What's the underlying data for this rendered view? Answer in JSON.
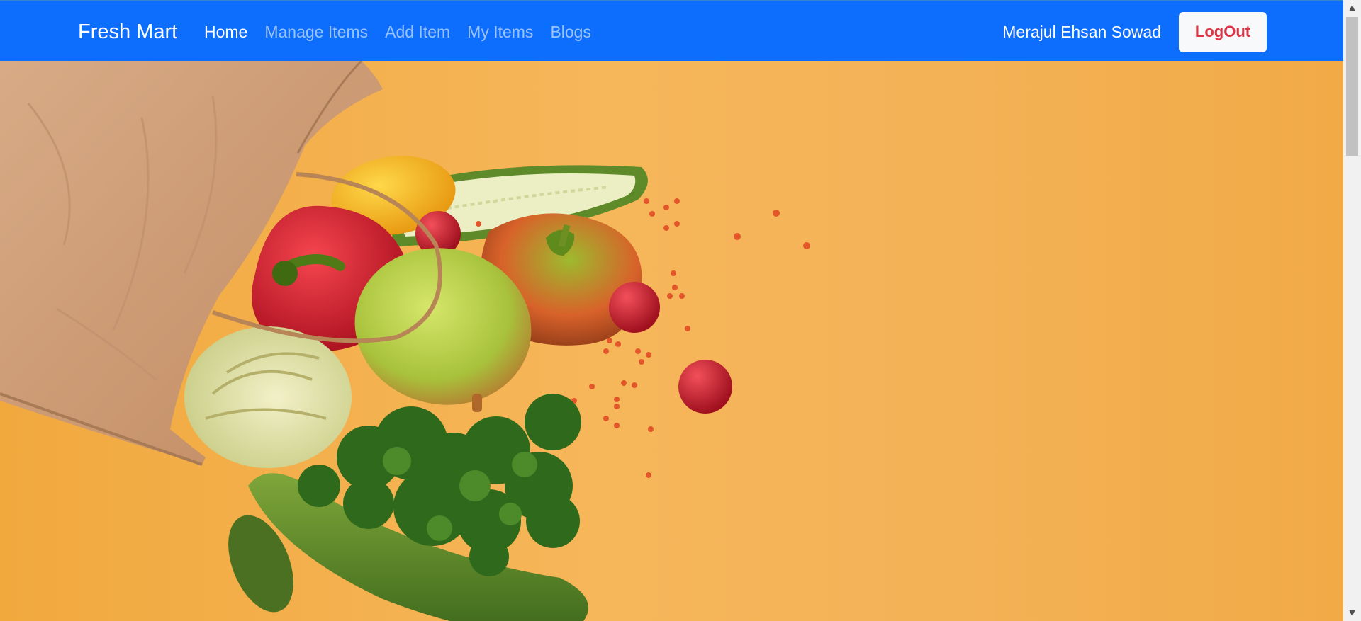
{
  "navbar": {
    "brand": "Fresh Mart",
    "links": [
      {
        "label": "Home",
        "active": true
      },
      {
        "label": "Manage Items",
        "active": false
      },
      {
        "label": "Add Item",
        "active": false
      },
      {
        "label": "My Items",
        "active": false
      },
      {
        "label": "Blogs",
        "active": false
      }
    ],
    "user_name": "Merajul Ehsan Sowad",
    "logout_label": "LogOut"
  },
  "hero": {
    "image": "groceries-paper-bag-with-vegetables"
  },
  "colors": {
    "navbar_bg": "#0d6efd",
    "logout_text": "#dc3545",
    "hero_bg": "#f4b257"
  },
  "scrollbar": {
    "up_icon": "▲",
    "down_icon": "▼"
  }
}
